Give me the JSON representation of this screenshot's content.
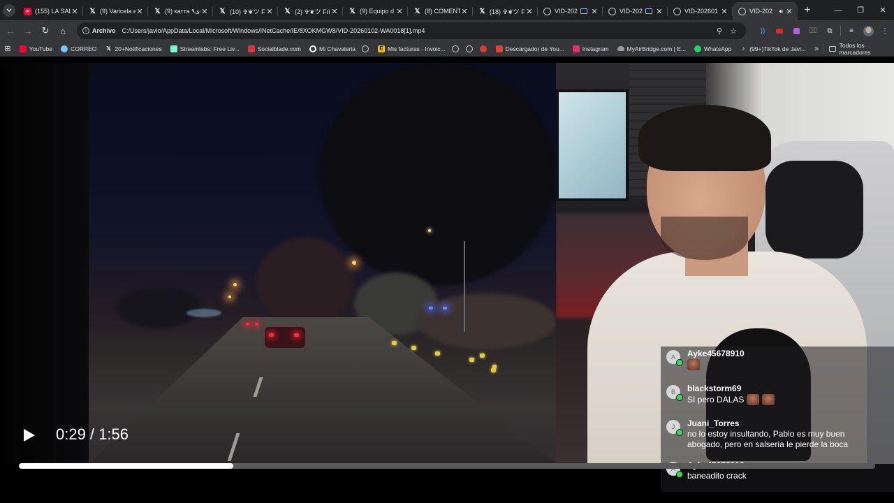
{
  "tabs": [
    {
      "icon": "youtube-icon",
      "title": "(155) LA SAL",
      "active": false
    },
    {
      "icon": "x-icon",
      "title": "(9) Varicela e",
      "active": false
    },
    {
      "icon": "x-icon",
      "title": "(9) катта ى٩(",
      "active": false
    },
    {
      "icon": "x-icon",
      "title": "(10) ✞❦ツ Fr",
      "active": false
    },
    {
      "icon": "x-icon",
      "title": "(2) ✞❦ツ Fri",
      "active": false
    },
    {
      "icon": "x-icon",
      "title": "(9) Equipo d",
      "active": false
    },
    {
      "icon": "x-icon",
      "title": "(8) COMENT",
      "active": false
    },
    {
      "icon": "x-icon",
      "title": "(18) ✞❦ツ Fr",
      "active": false
    },
    {
      "icon": "globe-icon",
      "title": "VID-202",
      "active": false,
      "extra": true
    },
    {
      "icon": "globe-icon",
      "title": "VID-202",
      "active": false,
      "extra": true
    },
    {
      "icon": "globe-icon",
      "title": "VID-202601",
      "active": false
    },
    {
      "icon": "globe-icon",
      "title": "VID-202",
      "active": true,
      "audio": true
    }
  ],
  "toolbar": {
    "omnibox_label": "Archivo",
    "url": "C:/Users/javio/AppData/Local/Microsoft/Windows/INetCache/IE/8XOKMGW8/VID-20260102-WA0018[1].mp4"
  },
  "bookmarks": [
    {
      "icon": "youtube-icon",
      "label": "YouTube",
      "color": "#ff0033"
    },
    {
      "icon": "drop-icon",
      "label": "CORREO",
      "color": "#7cc4ff"
    },
    {
      "icon": "x-icon",
      "label": "20+Notificaciones",
      "color": "#ffffff"
    },
    {
      "icon": "streamlabs-icon",
      "label": "Streamlabs: Free Liv...",
      "color": "#80f5d2"
    },
    {
      "icon": "socialblade-icon",
      "label": "Socialblade.com",
      "color": "#d9363e"
    },
    {
      "icon": "threads-icon",
      "label": "Mi Chavaleria",
      "color": "#ffffff"
    },
    {
      "icon": "globe-icon",
      "label": "",
      "color": "#d0d0d0"
    },
    {
      "icon": "facturas-icon",
      "label": "Mis facturas - Invoic...",
      "color": "#f2c200"
    },
    {
      "icon": "globe-icon",
      "label": "",
      "color": "#d0d0d0"
    },
    {
      "icon": "globe-icon",
      "label": "",
      "color": "#d0d0d0"
    },
    {
      "icon": "tomato-icon",
      "label": "",
      "color": "#d93c2f"
    },
    {
      "icon": "download-icon",
      "label": "Descargador de You...",
      "color": "#e0403c"
    },
    {
      "icon": "instagram-icon",
      "label": "Instagram",
      "color": "#e1306c"
    },
    {
      "icon": "cloud-icon",
      "label": "MyAirBridge.com | E...",
      "color": "#9a9a9a"
    },
    {
      "icon": "whatsapp-icon",
      "label": "WhatsApp",
      "color": "#25d366"
    },
    {
      "icon": "tiktok-icon",
      "label": "(99+)TikTok de Javi...",
      "color": "#ffffff"
    }
  ],
  "bookmarks_all": "Todos los marcadores",
  "player": {
    "time": "0:29 / 1:56",
    "progress": 0.25
  },
  "chat": [
    {
      "initial": "A",
      "user": "Ayke45678910",
      "text": "",
      "emotes": 1
    },
    {
      "initial": "B",
      "user": "blackstorm69",
      "text": "SI pero DALAS",
      "emotes": 2
    },
    {
      "initial": "J",
      "user": "Juani_Torres",
      "text": "no lo estoy insultando, Pablo es muy buen",
      "text2": "abogado, pero en salseria le pierde la boca",
      "emotes": 0
    },
    {
      "initial": "A",
      "user": "Ayke45678910",
      "text": "baneadito crack",
      "emotes": 0
    }
  ]
}
